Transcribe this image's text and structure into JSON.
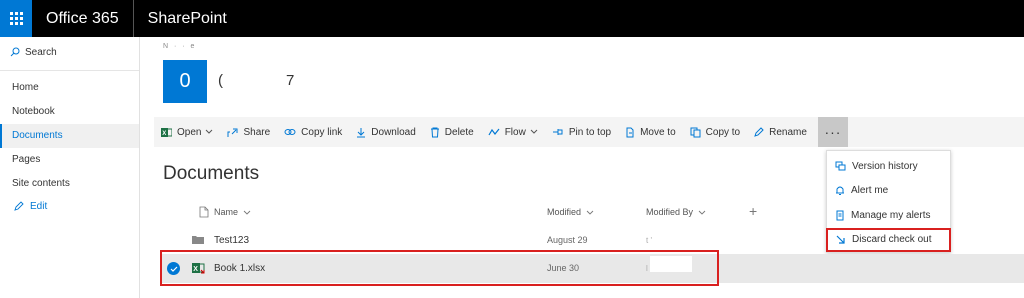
{
  "suitebar": {
    "app_title": "Office 365",
    "site_title": "SharePoint"
  },
  "leftnav": {
    "search_label": "Search",
    "items": [
      {
        "label": "Home"
      },
      {
        "label": "Notebook"
      },
      {
        "label": "Documents",
        "active": true
      },
      {
        "label": "Pages"
      },
      {
        "label": "Site contents"
      }
    ],
    "edit_label": "Edit"
  },
  "site": {
    "breadcrumb": "N · · e",
    "logo_letter": "0",
    "title_start": "(",
    "title_end": "7"
  },
  "commandbar": {
    "open": "Open",
    "share": "Share",
    "copy_link": "Copy link",
    "download": "Download",
    "delete": "Delete",
    "flow": "Flow",
    "pin_to_top": "Pin to top",
    "move_to": "Move to",
    "copy_to": "Copy to",
    "rename": "Rename",
    "more": "···"
  },
  "dropdown": {
    "items": [
      {
        "label": "Version history"
      },
      {
        "label": "Alert me"
      },
      {
        "label": "Manage my alerts"
      },
      {
        "label": "Discard check out"
      }
    ]
  },
  "documents": {
    "heading": "Documents",
    "columns": {
      "name": "Name",
      "modified": "Modified",
      "modified_by": "Modified By"
    },
    "add_column": "+",
    "rows": [
      {
        "name": "Test123",
        "modified": "August 29",
        "modified_by": "t '",
        "type": "folder"
      },
      {
        "name": "Book 1.xlsx",
        "modified": "June 30",
        "modified_by": "l",
        "type": "excel-checked-out",
        "selected": true
      }
    ]
  },
  "colors": {
    "accent": "#0078d4",
    "highlight": "#d9201f",
    "suitebar": "#000000"
  }
}
